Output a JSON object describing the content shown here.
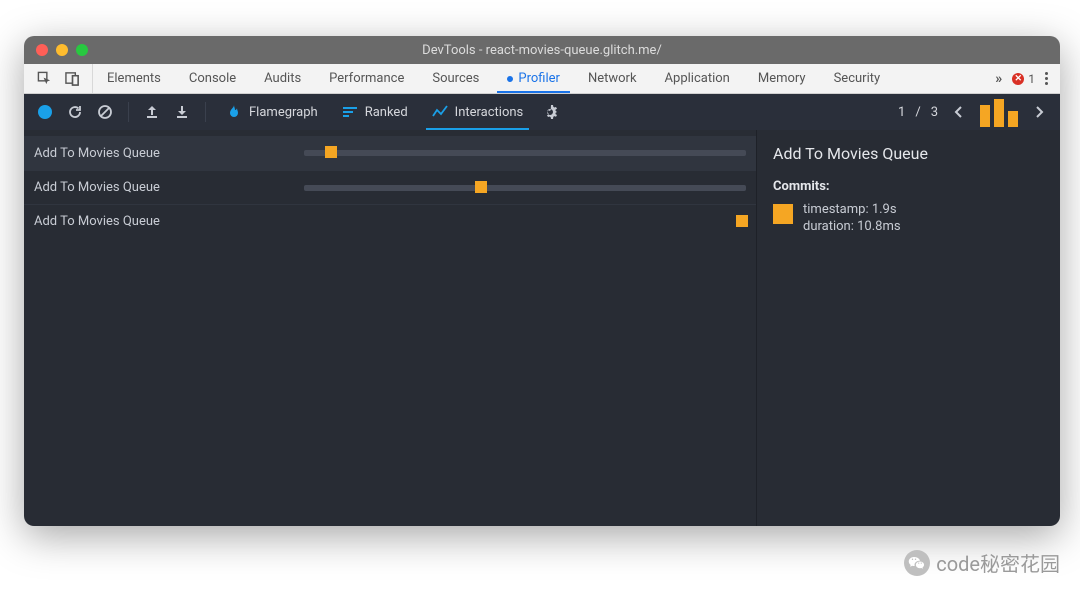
{
  "window": {
    "title": "DevTools - react-movies-queue.glitch.me/"
  },
  "tabstrip": {
    "tabs": [
      "Elements",
      "Console",
      "Audits",
      "Performance",
      "Sources",
      "Profiler",
      "Network",
      "Application",
      "Memory",
      "Security"
    ],
    "active": "Profiler",
    "error_count": "1"
  },
  "toolbar": {
    "views": {
      "flamegraph": "Flamegraph",
      "ranked": "Ranked",
      "interactions": "Interactions"
    },
    "active_view": "Interactions",
    "commit_nav": {
      "current": "1",
      "sep": "/",
      "total": "3"
    }
  },
  "interactions": [
    {
      "label": "Add To Movies Queue",
      "marker_pct": 6,
      "has_track": true,
      "selected": true
    },
    {
      "label": "Add To Movies Queue",
      "marker_pct": 40,
      "has_track": true,
      "selected": false
    },
    {
      "label": "Add To Movies Queue",
      "marker_pct": 99,
      "has_track": false,
      "selected": false
    }
  ],
  "details": {
    "title": "Add To Movies Queue",
    "commits_header": "Commits:",
    "commit": {
      "timestamp_label": "timestamp: 1.9s",
      "duration_label": "duration: 10.8ms"
    }
  },
  "watermark": {
    "text": "code秘密花园"
  }
}
